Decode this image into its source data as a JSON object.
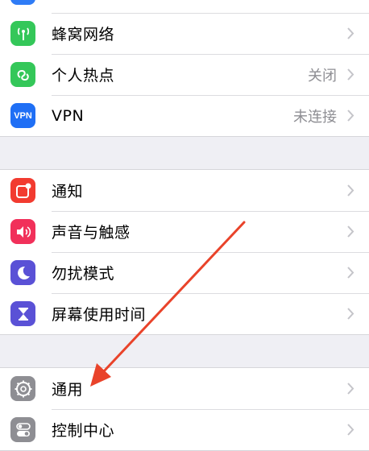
{
  "settings": {
    "group_network": [
      {
        "label": "",
        "value": "",
        "icon": "partial-blue-icon",
        "color": "#2f7cf6"
      },
      {
        "label": "蜂窝网络",
        "value": "",
        "icon": "cellular-icon",
        "color": "#34c759"
      },
      {
        "label": "个人热点",
        "value": "关闭",
        "icon": "hotspot-icon",
        "color": "#34c759"
      },
      {
        "label": "VPN",
        "value": "未连接",
        "icon": "vpn-icon",
        "color": "#1f6ff5",
        "icon_text": "VPN"
      }
    ],
    "group_notify": [
      {
        "label": "通知",
        "value": "",
        "icon": "notifications-icon",
        "color": "#f23b30"
      },
      {
        "label": "声音与触感",
        "value": "",
        "icon": "sounds-icon",
        "color": "#f1305a"
      },
      {
        "label": "勿扰模式",
        "value": "",
        "icon": "moon-icon",
        "color": "#5a51d6"
      },
      {
        "label": "屏幕使用时间",
        "value": "",
        "icon": "hourglass-icon",
        "color": "#5a51d6"
      }
    ],
    "group_general": [
      {
        "label": "通用",
        "value": "",
        "icon": "gear-icon",
        "color": "#8e8e93"
      },
      {
        "label": "控制中心",
        "value": "",
        "icon": "toggles-icon",
        "color": "#8e8e93"
      }
    ]
  },
  "colors": {
    "accent_arrow": "#e9432a",
    "chevron": "#c4c4c9",
    "background": "#efeff4"
  }
}
